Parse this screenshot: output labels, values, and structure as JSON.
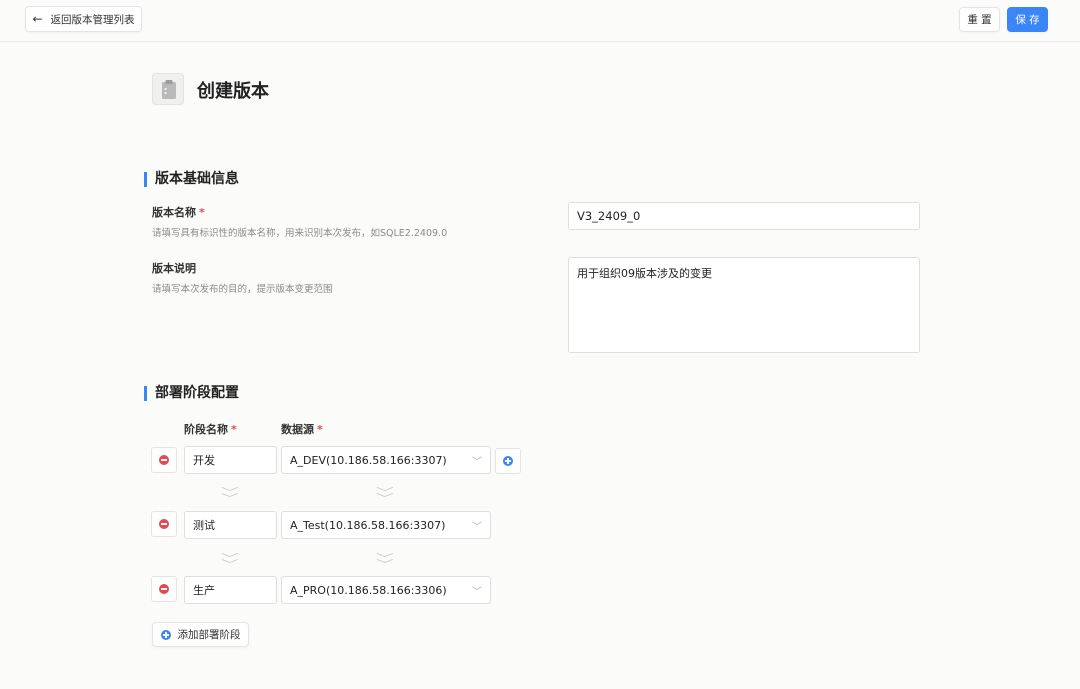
{
  "header": {
    "back_label": "返回版本管理列表",
    "reset_label": "重 置",
    "save_label": "保 存"
  },
  "page": {
    "title": "创建版本"
  },
  "basic_info": {
    "section_title": "版本基础信息",
    "name": {
      "label": "版本名称",
      "required_mark": "*",
      "help": "请填写具有标识性的版本名称，用来识别本次发布，如SQLE2.2409.0",
      "value": "V3_2409_0"
    },
    "description": {
      "label": "版本说明",
      "help": "请填写本次发布的目的，提示版本变更范围",
      "value": "用于组织09版本涉及的变更"
    }
  },
  "deploy": {
    "section_title": "部署阶段配置",
    "col_stage": "阶段名称",
    "col_datasource": "数据源",
    "required_mark": "*",
    "stages": [
      {
        "name": "开发",
        "datasource": "A_DEV(10.186.58.166:3307)"
      },
      {
        "name": "测试",
        "datasource": "A_Test(10.186.58.166:3307)"
      },
      {
        "name": "生产",
        "datasource": "A_PRO(10.186.58.166:3306)"
      }
    ],
    "add_stage_label": "添加部署阶段"
  },
  "colors": {
    "accent": "#3b86f7",
    "danger": "#e5484d"
  }
}
